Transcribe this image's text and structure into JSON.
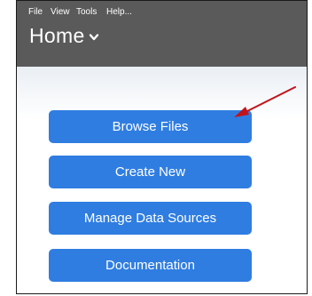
{
  "menu": {
    "items": [
      "File",
      "View",
      "Tools",
      "Help..."
    ]
  },
  "header": {
    "title": "Home"
  },
  "buttons": {
    "browse": "Browse Files",
    "create": "Create New",
    "manage": "Manage Data Sources",
    "docs": "Documentation"
  },
  "colors": {
    "header_bg": "#5a5a5a",
    "button_bg": "#2f7de1",
    "annotation_arrow": "#c0141c"
  },
  "icons": {
    "title_dropdown": "chevron-down-icon",
    "annotation": "arrow-icon"
  }
}
